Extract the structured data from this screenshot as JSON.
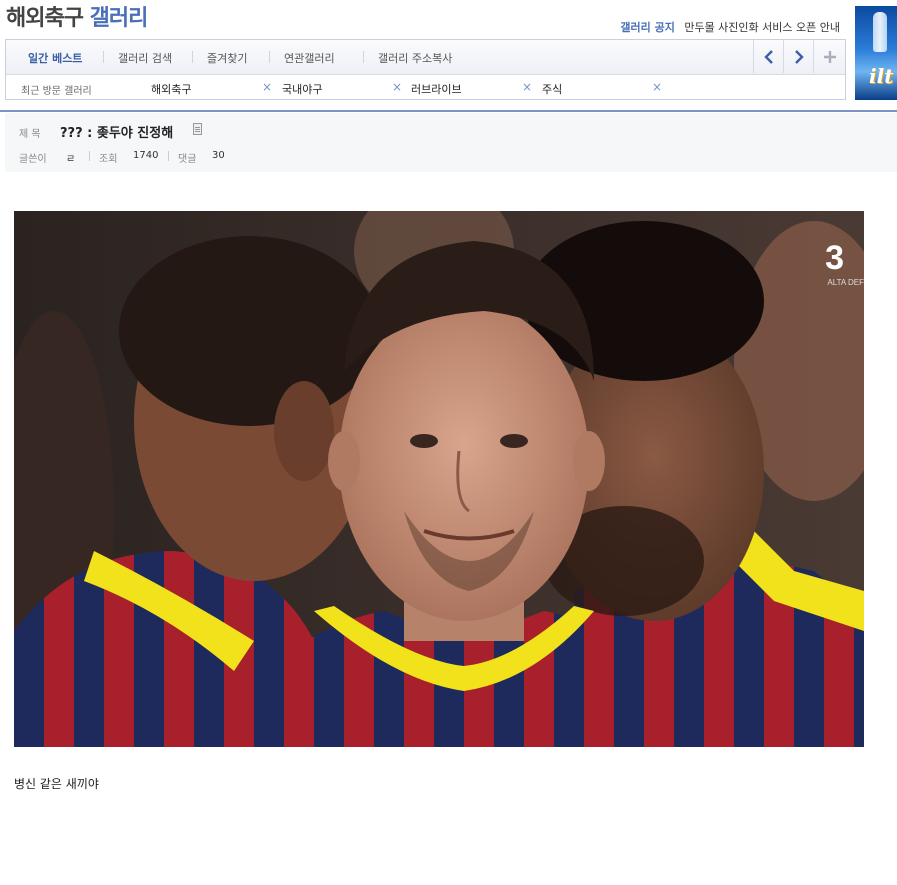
{
  "header": {
    "title_part1": "해외축구",
    "title_part2": "갤러리",
    "notice_label": "갤러리 공지",
    "notice_text": "만두몰 사진인화 서비스 오픈 안내"
  },
  "ad": {
    "logo_text": "ilt"
  },
  "nav": {
    "tabs": [
      {
        "label": "일간 베스트"
      },
      {
        "label": "갤러리 검색"
      },
      {
        "label": "즐겨찾기"
      },
      {
        "label": "연관갤러리"
      },
      {
        "label": "갤러리 주소복사"
      }
    ],
    "recent_label": "최근 방문 갤러리",
    "recent_items": [
      {
        "label": "해외축구"
      },
      {
        "label": "국내야구"
      },
      {
        "label": "러브라이브"
      },
      {
        "label": "주식"
      }
    ],
    "remove_glyph": "×"
  },
  "post": {
    "title_label": "제 목",
    "title": "??? : 좆두야 진정해",
    "author_label": "글쓴이",
    "author": "ㄹ",
    "views_label": "조회",
    "views": "1740",
    "comments_label": "댓글",
    "comments": "30",
    "body": "병신 같은 새끼야"
  },
  "photo": {
    "overlay_text": "3",
    "overlay_sub": "ALTA DEF"
  },
  "colors": {
    "accent": "#4a6fb8",
    "jersey_red": "#a8202c",
    "jersey_blue": "#1e2a5c",
    "jersey_yellow": "#f2e21c"
  }
}
